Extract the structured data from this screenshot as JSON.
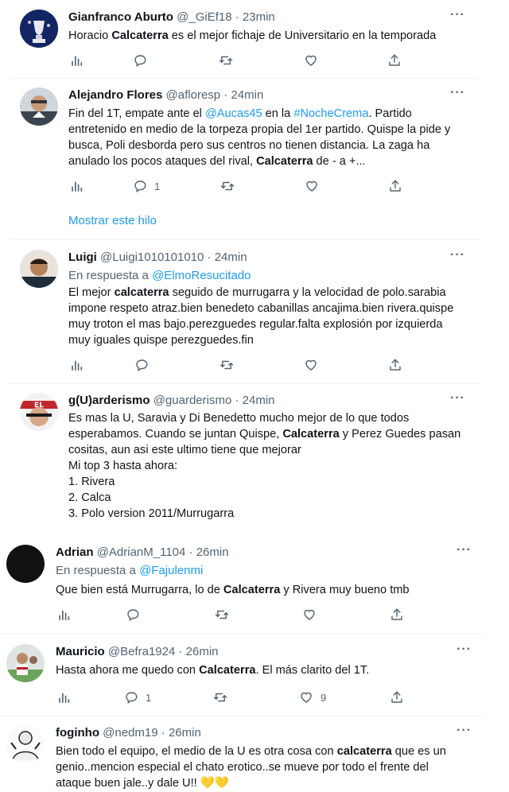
{
  "tweets": [
    {
      "name": "Gianfranco Aburto",
      "handle": "@_GiEf18",
      "dot": "·",
      "time": "23min",
      "text": [
        [
          "Horacio ",
          [
            "b",
            "Calcaterra"
          ],
          " es el mejor fichaje de Universitario en la temporada"
        ]
      ],
      "reply_count": "",
      "like_count": ""
    },
    {
      "name": "Alejandro Flores",
      "handle": "@afloresp",
      "dot": "·",
      "time": "24min",
      "text": [
        [
          "Fin del 1T, empate ante el ",
          [
            "a",
            "@Aucas45"
          ],
          " en la ",
          [
            "a",
            "#NocheCrema"
          ],
          ". Partido"
        ],
        [
          "entretenido en medio de la torpeza propia del 1er partido. Quispe la pide y"
        ],
        [
          "busca, Poli desborda pero sus centros no tienen distancia. La zaga ha"
        ],
        [
          "anulado los pocos ataques del rival, ",
          [
            "b",
            "Calcaterra"
          ],
          " de - a +..."
        ]
      ],
      "reply_count": "1",
      "like_count": "",
      "show_thread": "Mostrar este hilo"
    },
    {
      "name": "Luigi",
      "handle": "@Luigi1010101010",
      "dot": "·",
      "time": "24min",
      "reply_prefix": "En respuesta a",
      "reply_to": "@ElmoResucitado",
      "text": [
        [
          "El mejor ",
          [
            "b",
            "calcaterra"
          ],
          " seguido de murrugarra y la velocidad de polo.sarabia"
        ],
        [
          "impone respeto atraz.bien benedeto cabanillas ancajima.bien rivera.quispe"
        ],
        [
          "muy troton el mas bajo.perezguedes regular.falta explosión por izquierda"
        ],
        [
          "muy iguales quispe perezguedes.fin"
        ]
      ],
      "reply_count": "",
      "like_count": ""
    },
    {
      "name": "g(U)arderismo",
      "handle": "@guarderismo",
      "dot": "·",
      "time": "24min",
      "text": [
        [
          "Es mas la U, Saravia y Di Benedetto mucho mejor de lo que todos"
        ],
        [
          "esperabamos. Cuando se juntan Quispe, ",
          [
            "b",
            "Calcaterra"
          ],
          " y Perez Guedes pasan"
        ],
        [
          "cositas, aun asi este ultimo tiene que mejorar"
        ],
        [
          "Mi top 3 hasta ahora:"
        ],
        [
          "1. Rivera"
        ],
        [
          "2. Calca"
        ],
        [
          "3. Polo version 2011/Murrugarra"
        ]
      ]
    },
    {
      "name": "Adrian",
      "handle": "@AdrianM_1104",
      "dot": "·",
      "time": "26min",
      "reply_prefix": "En respuesta a",
      "reply_to": "@Fajulenmi",
      "text": [
        [
          "Que bien está Murrugarra, lo de ",
          [
            "b",
            "Calcaterra"
          ],
          " y Rivera muy bueno tmb"
        ]
      ],
      "reply_count": "",
      "like_count": ""
    },
    {
      "name": "Mauricio",
      "handle": "@Befra1924",
      "dot": "·",
      "time": "26min",
      "text": [
        [
          "Hasta ahora me quedo con ",
          [
            "b",
            "Calcaterra"
          ],
          ". El más clarito del 1T."
        ]
      ],
      "reply_count": "1",
      "like_count": "9"
    },
    {
      "name": "foginho",
      "handle": "@nedm19",
      "dot": "·",
      "time": "26min",
      "text": [
        [
          "Bien todo el equipo, el medio de la U es otra cosa con ",
          [
            "b",
            "calcaterra"
          ],
          " que es un"
        ],
        [
          "genio..mencion especial el chato erotico..se mueve por todo el frente del"
        ],
        [
          "ataque buen jale..y dale U!! ",
          [
            "e",
            "💛💛"
          ]
        ]
      ]
    }
  ],
  "icons": [
    "analytics-icon",
    "reply-icon",
    "retweet-icon",
    "like-icon",
    "share-icon",
    "more-icon"
  ],
  "colors": {
    "accent": "#1d9bf0",
    "secondary": "#536471",
    "text": "#0f1419"
  }
}
